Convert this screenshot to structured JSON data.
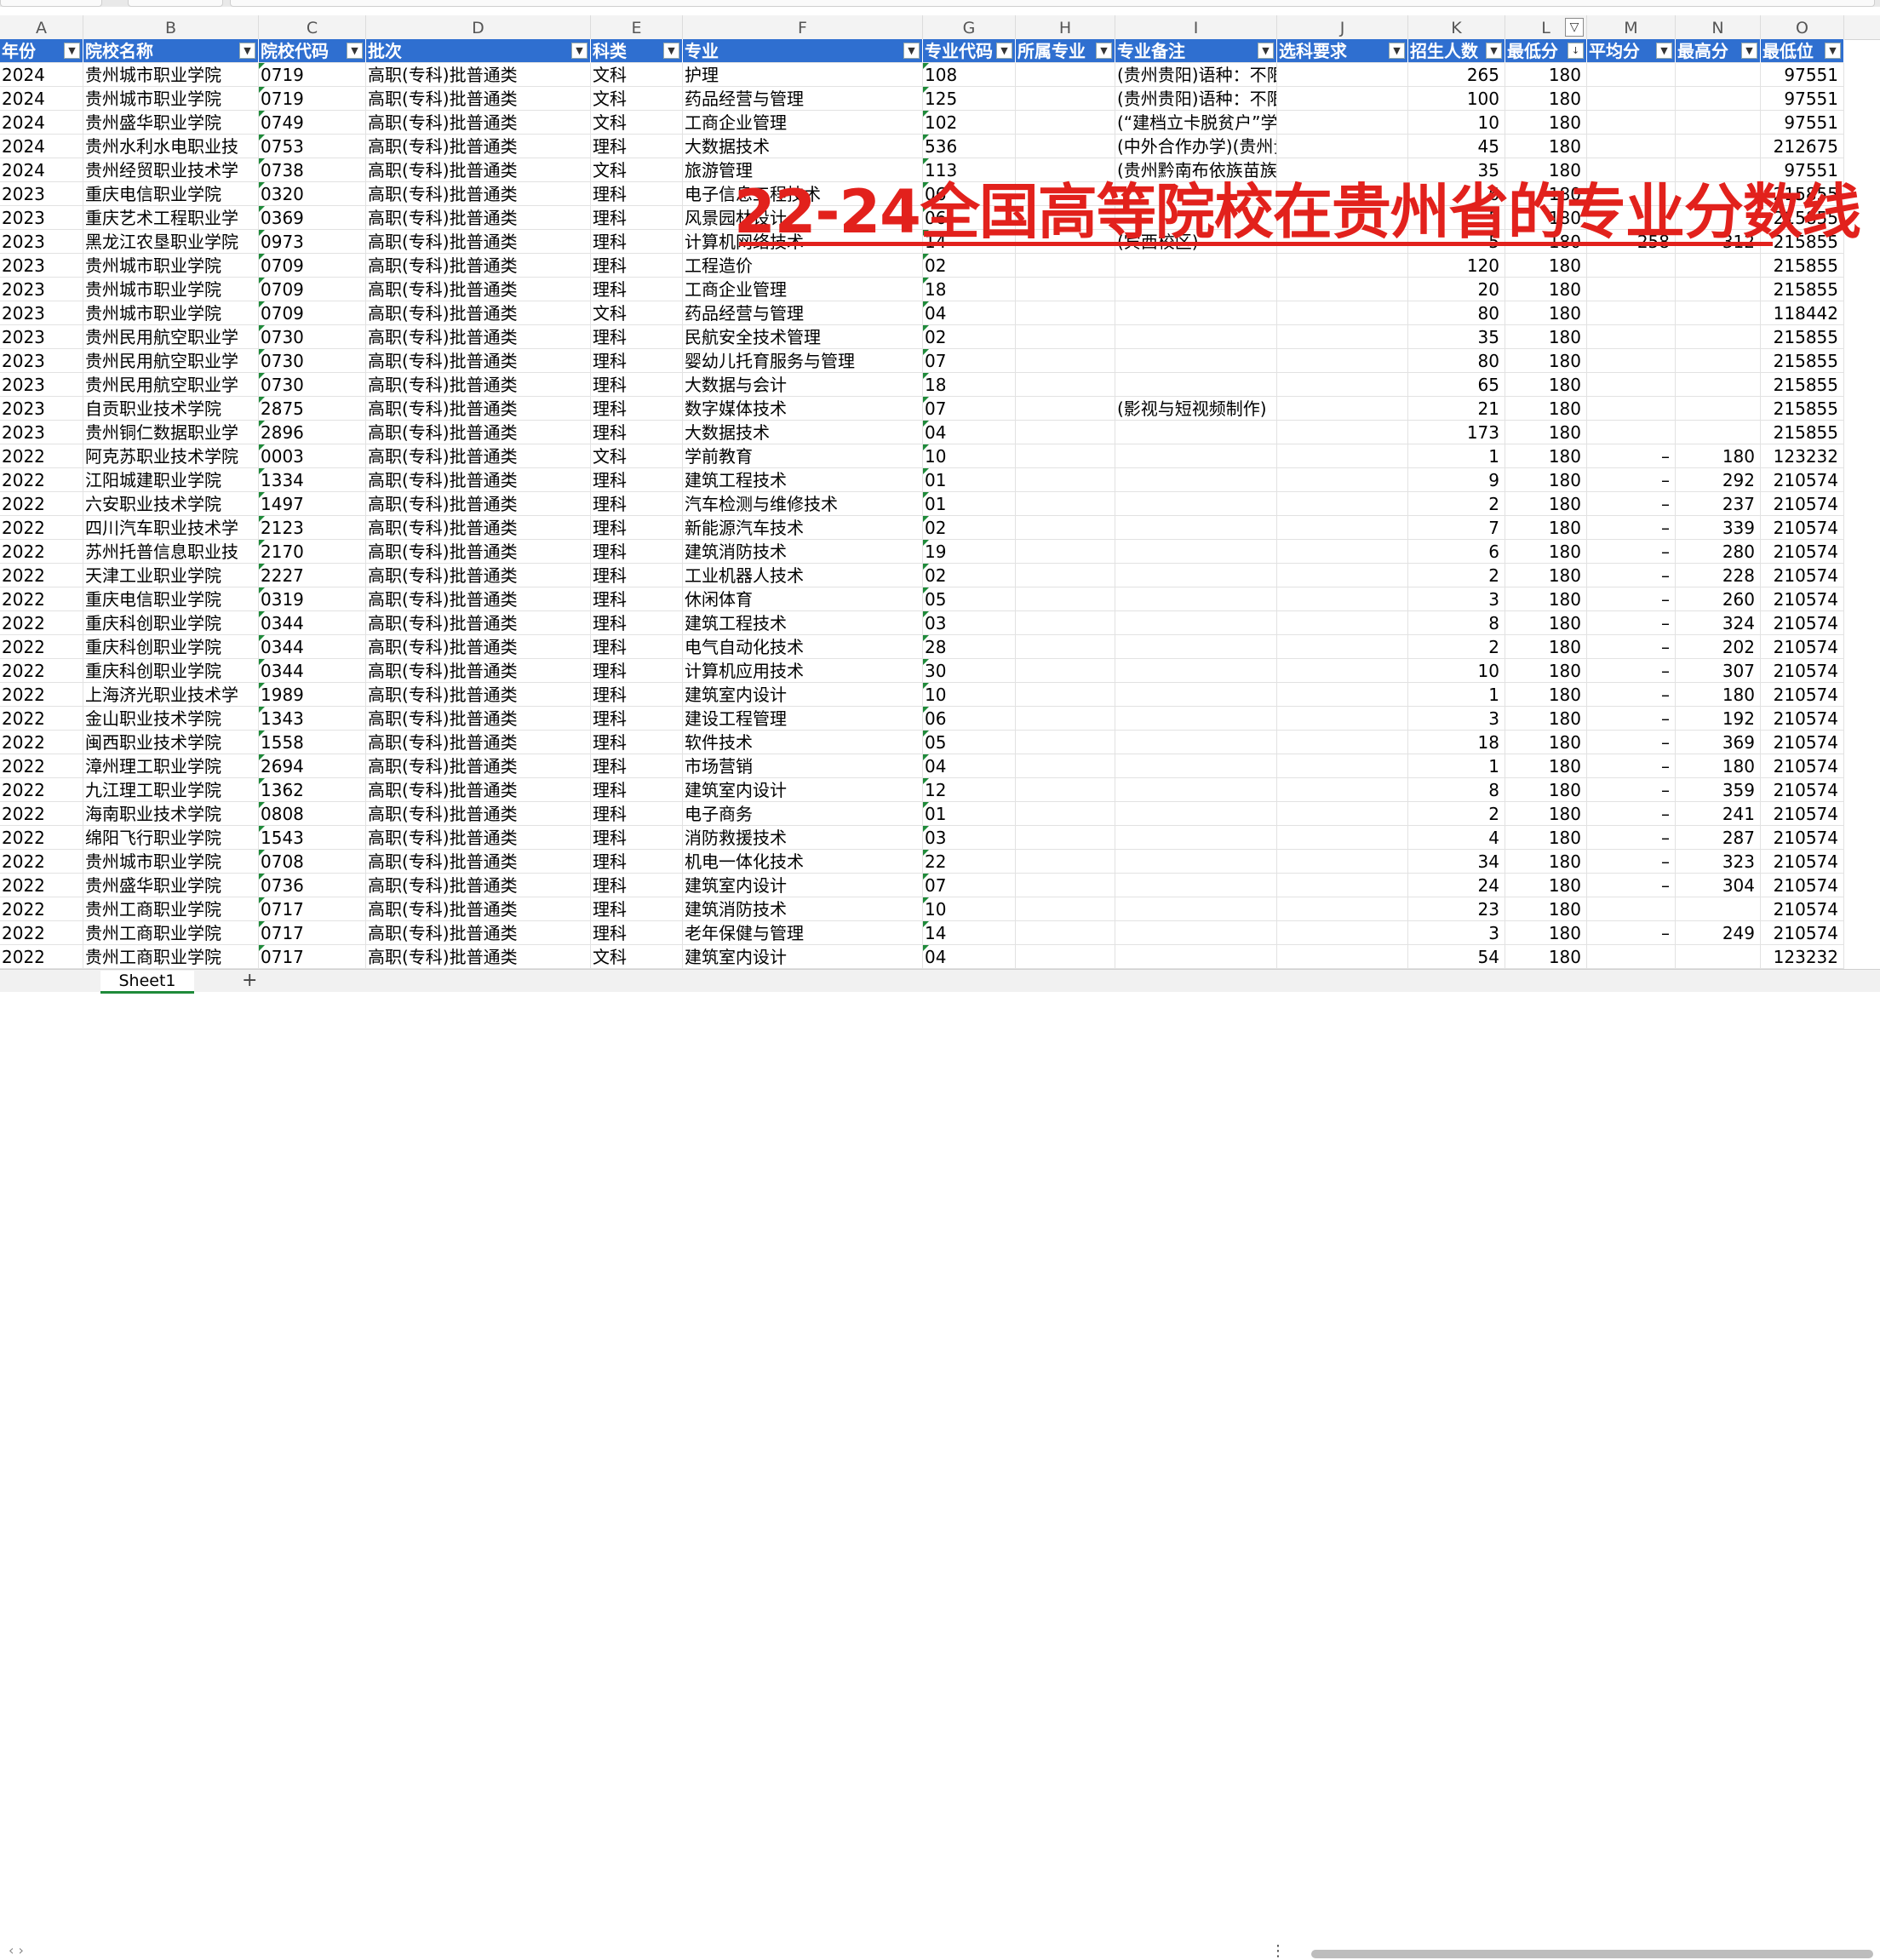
{
  "columns_letters": [
    "A",
    "B",
    "C",
    "D",
    "E",
    "F",
    "G",
    "H",
    "I",
    "J",
    "K",
    "L",
    "M",
    "N",
    "O"
  ],
  "header": [
    "年份",
    "院校名称",
    "院校代码",
    "批次",
    "科类",
    "专业",
    "专业代码",
    "所属专业",
    "专业备注",
    "选科要求",
    "招生人数",
    "最低分",
    "平均分",
    "最高分",
    "最低位"
  ],
  "overlay": {
    "title": "22-24全国高等院校在贵州省的专业分数线"
  },
  "rows": [
    [
      "2024",
      "贵州城市职业学院",
      "0719",
      "高职(专科)批普通类",
      "文科",
      "护理",
      "108",
      "",
      "(贵州贵阳)语种：不限",
      "",
      "265",
      "180",
      "",
      "",
      "97551"
    ],
    [
      "2024",
      "贵州城市职业学院",
      "0719",
      "高职(专科)批普通类",
      "文科",
      "药品经营与管理",
      "125",
      "",
      "(贵州贵阳)语种：不限",
      "",
      "100",
      "180",
      "",
      "",
      "97551"
    ],
    [
      "2024",
      "贵州盛华职业学院",
      "0749",
      "高职(专科)批普通类",
      "文科",
      "工商企业管理",
      "102",
      "",
      "(“建档立卡脱贫户”学生三年零学",
      "",
      "10",
      "180",
      "",
      "",
      "97551"
    ],
    [
      "2024",
      "贵州水利水电职业技",
      "0753",
      "高职(专科)批普通类",
      "理科",
      "大数据技术",
      "536",
      "",
      "(中外合作办学)(贵州贵阳)语种：不",
      "",
      "45",
      "180",
      "",
      "",
      "212675"
    ],
    [
      "2024",
      "贵州经贸职业技术学",
      "0738",
      "高职(专科)批普通类",
      "文科",
      "旅游管理",
      "113",
      "",
      "(贵州黔南布依族苗族自治州)语种：",
      "",
      "35",
      "180",
      "",
      "",
      "97551"
    ],
    [
      "2023",
      "重庆电信职业学院",
      "0320",
      "高职(专科)批普通类",
      "理科",
      "电子信息工程技术",
      "06",
      "",
      "",
      "",
      "6",
      "180",
      "",
      "",
      "215855"
    ],
    [
      "2023",
      "重庆艺术工程职业学",
      "0369",
      "高职(专科)批普通类",
      "理科",
      "风景园林设计",
      "06",
      "",
      "",
      "",
      "5",
      "180",
      "",
      "",
      "215855"
    ],
    [
      "2023",
      "黑龙江农垦职业学院",
      "0973",
      "高职(专科)批普通类",
      "理科",
      "计算机网络技术",
      "14",
      "",
      "(宾西校区)",
      "",
      "5",
      "180",
      "258",
      "312",
      "215855"
    ],
    [
      "2023",
      "贵州城市职业学院",
      "0709",
      "高职(专科)批普通类",
      "理科",
      "工程造价",
      "02",
      "",
      "",
      "",
      "120",
      "180",
      "",
      "",
      "215855"
    ],
    [
      "2023",
      "贵州城市职业学院",
      "0709",
      "高职(专科)批普通类",
      "理科",
      "工商企业管理",
      "18",
      "",
      "",
      "",
      "20",
      "180",
      "",
      "",
      "215855"
    ],
    [
      "2023",
      "贵州城市职业学院",
      "0709",
      "高职(专科)批普通类",
      "文科",
      "药品经营与管理",
      "04",
      "",
      "",
      "",
      "80",
      "180",
      "",
      "",
      "118442"
    ],
    [
      "2023",
      "贵州民用航空职业学",
      "0730",
      "高职(专科)批普通类",
      "理科",
      "民航安全技术管理",
      "02",
      "",
      "",
      "",
      "35",
      "180",
      "",
      "",
      "215855"
    ],
    [
      "2023",
      "贵州民用航空职业学",
      "0730",
      "高职(专科)批普通类",
      "理科",
      "婴幼儿托育服务与管理",
      "07",
      "",
      "",
      "",
      "80",
      "180",
      "",
      "",
      "215855"
    ],
    [
      "2023",
      "贵州民用航空职业学",
      "0730",
      "高职(专科)批普通类",
      "理科",
      "大数据与会计",
      "18",
      "",
      "",
      "",
      "65",
      "180",
      "",
      "",
      "215855"
    ],
    [
      "2023",
      "自贡职业技术学院",
      "2875",
      "高职(专科)批普通类",
      "理科",
      "数字媒体技术",
      "07",
      "",
      "(影视与短视频制作)",
      "",
      "21",
      "180",
      "",
      "",
      "215855"
    ],
    [
      "2023",
      "贵州铜仁数据职业学",
      "2896",
      "高职(专科)批普通类",
      "理科",
      "大数据技术",
      "04",
      "",
      "",
      "",
      "173",
      "180",
      "",
      "",
      "215855"
    ],
    [
      "2022",
      "阿克苏职业技术学院",
      "0003",
      "高职(专科)批普通类",
      "文科",
      "学前教育",
      "10",
      "",
      "",
      "",
      "1",
      "180",
      "–",
      "180",
      "123232"
    ],
    [
      "2022",
      "江阳城建职业学院",
      "1334",
      "高职(专科)批普通类",
      "理科",
      "建筑工程技术",
      "01",
      "",
      "",
      "",
      "9",
      "180",
      "–",
      "292",
      "210574"
    ],
    [
      "2022",
      "六安职业技术学院",
      "1497",
      "高职(专科)批普通类",
      "理科",
      "汽车检测与维修技术",
      "01",
      "",
      "",
      "",
      "2",
      "180",
      "–",
      "237",
      "210574"
    ],
    [
      "2022",
      "四川汽车职业技术学",
      "2123",
      "高职(专科)批普通类",
      "理科",
      "新能源汽车技术",
      "02",
      "",
      "",
      "",
      "7",
      "180",
      "–",
      "339",
      "210574"
    ],
    [
      "2022",
      "苏州托普信息职业技",
      "2170",
      "高职(专科)批普通类",
      "理科",
      "建筑消防技术",
      "19",
      "",
      "",
      "",
      "6",
      "180",
      "–",
      "280",
      "210574"
    ],
    [
      "2022",
      "天津工业职业学院",
      "2227",
      "高职(专科)批普通类",
      "理科",
      "工业机器人技术",
      "02",
      "",
      "",
      "",
      "2",
      "180",
      "–",
      "228",
      "210574"
    ],
    [
      "2022",
      "重庆电信职业学院",
      "0319",
      "高职(专科)批普通类",
      "理科",
      "休闲体育",
      "05",
      "",
      "",
      "",
      "3",
      "180",
      "–",
      "260",
      "210574"
    ],
    [
      "2022",
      "重庆科创职业学院",
      "0344",
      "高职(专科)批普通类",
      "理科",
      "建筑工程技术",
      "03",
      "",
      "",
      "",
      "8",
      "180",
      "–",
      "324",
      "210574"
    ],
    [
      "2022",
      "重庆科创职业学院",
      "0344",
      "高职(专科)批普通类",
      "理科",
      "电气自动化技术",
      "28",
      "",
      "",
      "",
      "2",
      "180",
      "–",
      "202",
      "210574"
    ],
    [
      "2022",
      "重庆科创职业学院",
      "0344",
      "高职(专科)批普通类",
      "理科",
      "计算机应用技术",
      "30",
      "",
      "",
      "",
      "10",
      "180",
      "–",
      "307",
      "210574"
    ],
    [
      "2022",
      "上海济光职业技术学",
      "1989",
      "高职(专科)批普通类",
      "理科",
      "建筑室内设计",
      "10",
      "",
      "",
      "",
      "1",
      "180",
      "–",
      "180",
      "210574"
    ],
    [
      "2022",
      "金山职业技术学院",
      "1343",
      "高职(专科)批普通类",
      "理科",
      "建设工程管理",
      "06",
      "",
      "",
      "",
      "3",
      "180",
      "–",
      "192",
      "210574"
    ],
    [
      "2022",
      "闽西职业技术学院",
      "1558",
      "高职(专科)批普通类",
      "理科",
      "软件技术",
      "05",
      "",
      "",
      "",
      "18",
      "180",
      "–",
      "369",
      "210574"
    ],
    [
      "2022",
      "漳州理工职业学院",
      "2694",
      "高职(专科)批普通类",
      "理科",
      "市场营销",
      "04",
      "",
      "",
      "",
      "1",
      "180",
      "–",
      "180",
      "210574"
    ],
    [
      "2022",
      "九江理工职业学院",
      "1362",
      "高职(专科)批普通类",
      "理科",
      "建筑室内设计",
      "12",
      "",
      "",
      "",
      "8",
      "180",
      "–",
      "359",
      "210574"
    ],
    [
      "2022",
      "海南职业技术学院",
      "0808",
      "高职(专科)批普通类",
      "理科",
      "电子商务",
      "01",
      "",
      "",
      "",
      "2",
      "180",
      "–",
      "241",
      "210574"
    ],
    [
      "2022",
      "绵阳飞行职业学院",
      "1543",
      "高职(专科)批普通类",
      "理科",
      "消防救援技术",
      "03",
      "",
      "",
      "",
      "4",
      "180",
      "–",
      "287",
      "210574"
    ],
    [
      "2022",
      "贵州城市职业学院",
      "0708",
      "高职(专科)批普通类",
      "理科",
      "机电一体化技术",
      "22",
      "",
      "",
      "",
      "34",
      "180",
      "–",
      "323",
      "210574"
    ],
    [
      "2022",
      "贵州盛华职业学院",
      "0736",
      "高职(专科)批普通类",
      "理科",
      "建筑室内设计",
      "07",
      "",
      "",
      "",
      "24",
      "180",
      "–",
      "304",
      "210574"
    ],
    [
      "2022",
      "贵州工商职业学院",
      "0717",
      "高职(专科)批普通类",
      "理科",
      "建筑消防技术",
      "10",
      "",
      "",
      "",
      "23",
      "180",
      "",
      "",
      "210574"
    ],
    [
      "2022",
      "贵州工商职业学院",
      "0717",
      "高职(专科)批普通类",
      "理科",
      "老年保健与管理",
      "14",
      "",
      "",
      "",
      "3",
      "180",
      "–",
      "249",
      "210574"
    ],
    [
      "2022",
      "贵州工商职业学院",
      "0717",
      "高职(专科)批普通类",
      "文科",
      "建筑室内设计",
      "04",
      "",
      "",
      "",
      "54",
      "180",
      "",
      "",
      "123232"
    ]
  ],
  "sheet": {
    "tab": "Sheet1",
    "add": "+",
    "more": "⋮"
  },
  "colors": {
    "header_bg": "#2f6fd0",
    "overlay": "#e2211c",
    "text_indicator": "#1f8a3a"
  },
  "icons": {
    "filter": "filter-dropdown-icon",
    "active_filter": "funnel-icon"
  }
}
